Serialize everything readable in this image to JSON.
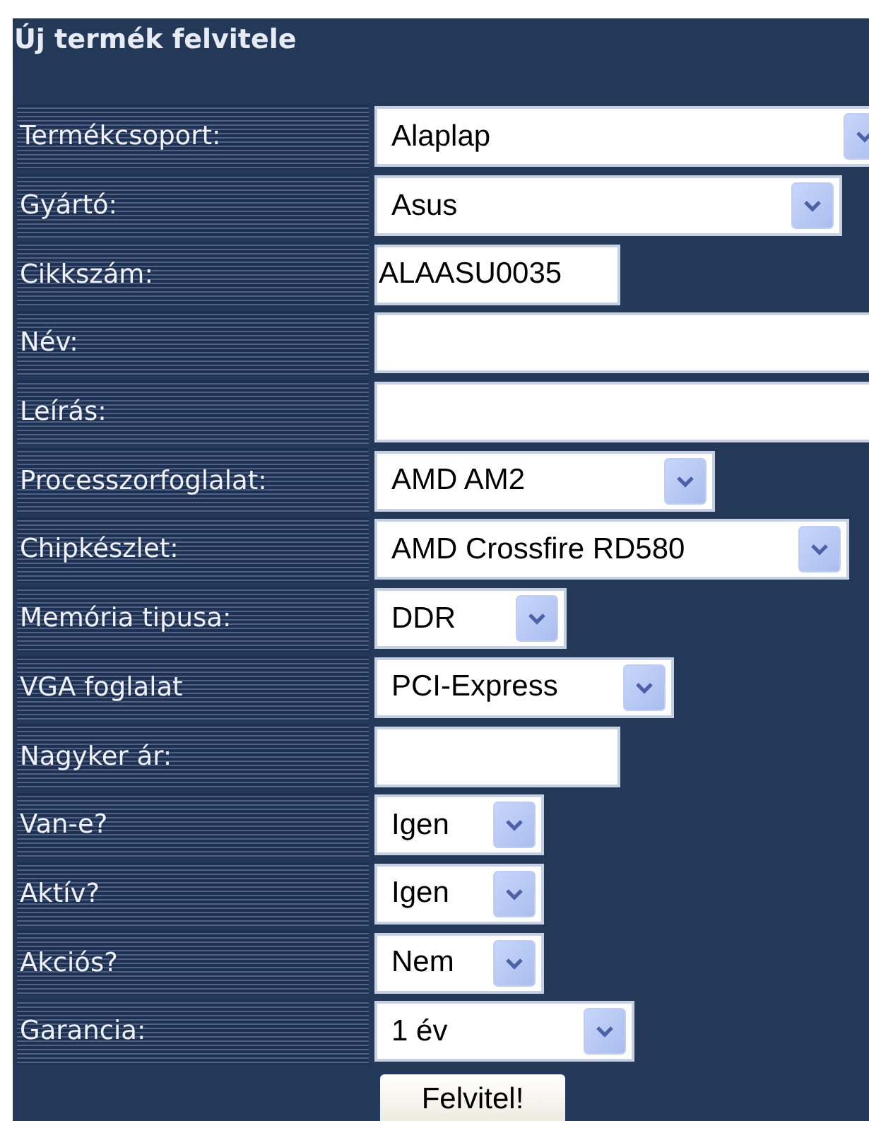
{
  "title": "Új termék felvitele",
  "fields": [
    {
      "label": "Termékcsoport:",
      "kind": "select",
      "value": "Alaplap"
    },
    {
      "label": "Gyártó:",
      "kind": "select",
      "value": "Asus"
    },
    {
      "label": "Cikkszám:",
      "kind": "text",
      "value": "ALAASU0035"
    },
    {
      "label": "Név:",
      "kind": "text"
    },
    {
      "label": "Leírás:",
      "kind": "text"
    },
    {
      "label": "Processzorfoglalat:",
      "kind": "select",
      "value": "AMD AM2"
    },
    {
      "label": "Chipkészlet:",
      "kind": "select",
      "value": "AMD Crossfire RD580"
    },
    {
      "label": "Memória tipusa:",
      "kind": "select",
      "value": "DDR"
    },
    {
      "label": "VGA foglalat",
      "kind": "select",
      "value": "PCI-Express"
    },
    {
      "label": "Nagyker ár:",
      "kind": "text"
    },
    {
      "label": "Van-e?",
      "kind": "select",
      "value": "Igen"
    },
    {
      "label": "Aktív?",
      "kind": "select",
      "value": "Igen"
    },
    {
      "label": "Akciós?",
      "kind": "select",
      "value": "Nem"
    },
    {
      "label": "Garancia:",
      "kind": "select",
      "value": "1 év"
    }
  ],
  "submit": "Felvitel!"
}
